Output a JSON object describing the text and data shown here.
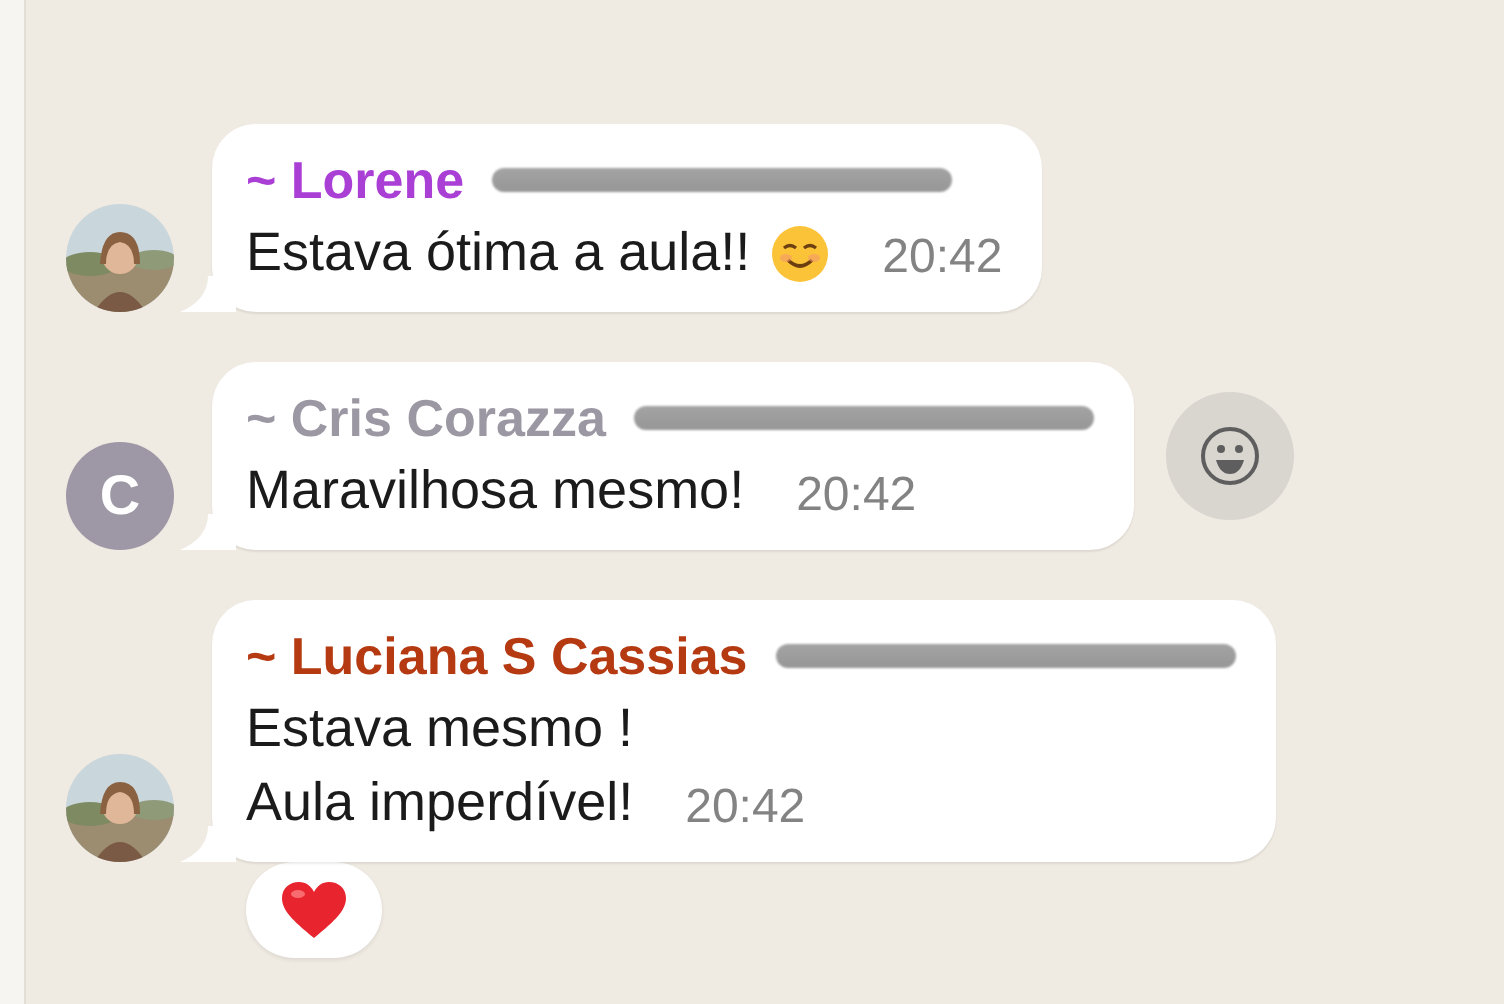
{
  "messages": [
    {
      "sender": "~ Lorene",
      "color": "#aa3fd5",
      "number_redacted": true,
      "avatar": {
        "kind": "picture"
      },
      "lines": [
        "Estava ótima a aula!!"
      ],
      "smiley": true,
      "time": "20:42"
    },
    {
      "sender": "~ Cris Corazza",
      "color": "#9c98a3",
      "number_redacted": true,
      "avatar": {
        "kind": "letter",
        "letter": "C",
        "color": "#9e97a6"
      },
      "lines": [
        "Maravilhosa mesmo!"
      ],
      "time": "20:42",
      "react_button": true
    },
    {
      "sender": "~ Luciana S Cassias",
      "color": "#b53a12",
      "number_redacted": true,
      "avatar": {
        "kind": "picture"
      },
      "lines": [
        "Estava mesmo !",
        "Aula imperdível!"
      ],
      "time": "20:42",
      "reaction": true
    }
  ]
}
